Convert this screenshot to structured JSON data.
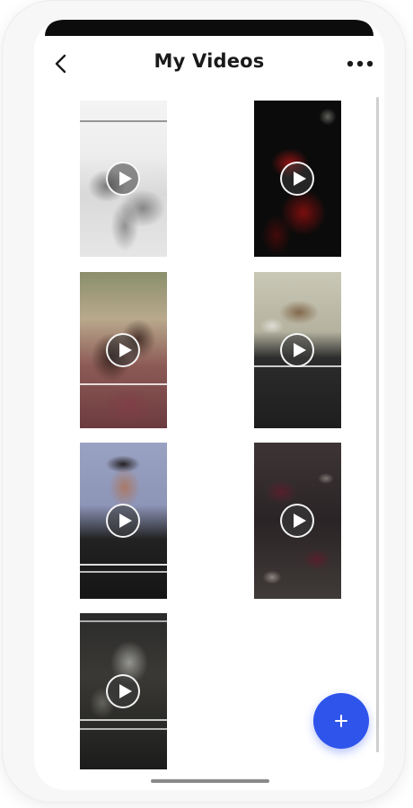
{
  "header": {
    "title": "My Videos",
    "back_icon": "chevron-left-icon",
    "menu_icon": "more-horizontal-icon"
  },
  "videos": [
    {
      "theme": "sketch-light"
    },
    {
      "theme": "dark-red"
    },
    {
      "theme": "couple-warm"
    },
    {
      "theme": "horse-text"
    },
    {
      "theme": "portrait-man"
    },
    {
      "theme": "cups-dark"
    },
    {
      "theme": "portrait-dark"
    }
  ],
  "play_icon": "play-circle-icon",
  "fab": {
    "icon": "plus-icon",
    "color": "#2f54eb"
  }
}
